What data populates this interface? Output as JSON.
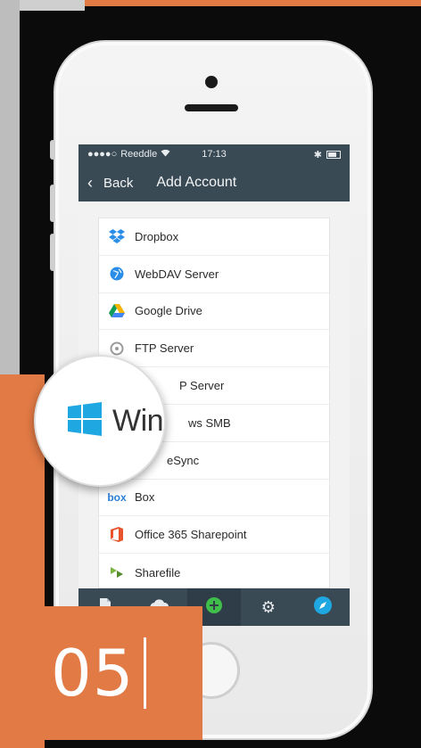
{
  "status_bar": {
    "carrier": "Reeddle",
    "time": "17:13",
    "signal_icon": "signal-dots-icon",
    "wifi_icon": "wifi-icon",
    "battery_icon": "battery-icon"
  },
  "nav": {
    "back_label": "Back",
    "title": "Add Account"
  },
  "accounts": [
    {
      "label": "Dropbox",
      "icon": "dropbox-icon",
      "color": "#2a8ee8"
    },
    {
      "label": "WebDAV Server",
      "icon": "globe-icon",
      "color": "#2a8ee8"
    },
    {
      "label": "Google Drive",
      "icon": "google-drive-icon",
      "color": "#f4b400"
    },
    {
      "label": "FTP Server",
      "icon": "ftp-icon",
      "color": "#9a9a9a"
    },
    {
      "label": "P Server",
      "icon": "server-icon",
      "color": "#4caf50"
    },
    {
      "label": "ws SMB",
      "icon": "windows-icon",
      "color": "#1ea7e1"
    },
    {
      "label": "eSync",
      "icon": "sync-icon",
      "color": "#4caf50"
    },
    {
      "label": "Box",
      "icon": "box-icon",
      "color": "#2a7fd6"
    },
    {
      "label": "Office 365 Sharepoint",
      "icon": "office-icon",
      "color": "#e8532c"
    },
    {
      "label": "Sharefile",
      "icon": "sharefile-icon",
      "color": "#7cb342"
    }
  ],
  "magnifier": {
    "text": "Win",
    "icon": "windows-logo-icon",
    "color": "#1ea7e1"
  },
  "tabs": [
    {
      "name": "documents-tab",
      "icon": "document-icon"
    },
    {
      "name": "cloud-tab",
      "icon": "cloud-icon"
    },
    {
      "name": "network-tab",
      "icon": "network-icon"
    },
    {
      "name": "settings-tab",
      "icon": "gear-icon"
    },
    {
      "name": "browser-tab",
      "icon": "compass-icon"
    }
  ],
  "step": {
    "number": "05"
  },
  "colors": {
    "accent_orange": "#e27a45",
    "nav_background": "#3a4a55"
  }
}
